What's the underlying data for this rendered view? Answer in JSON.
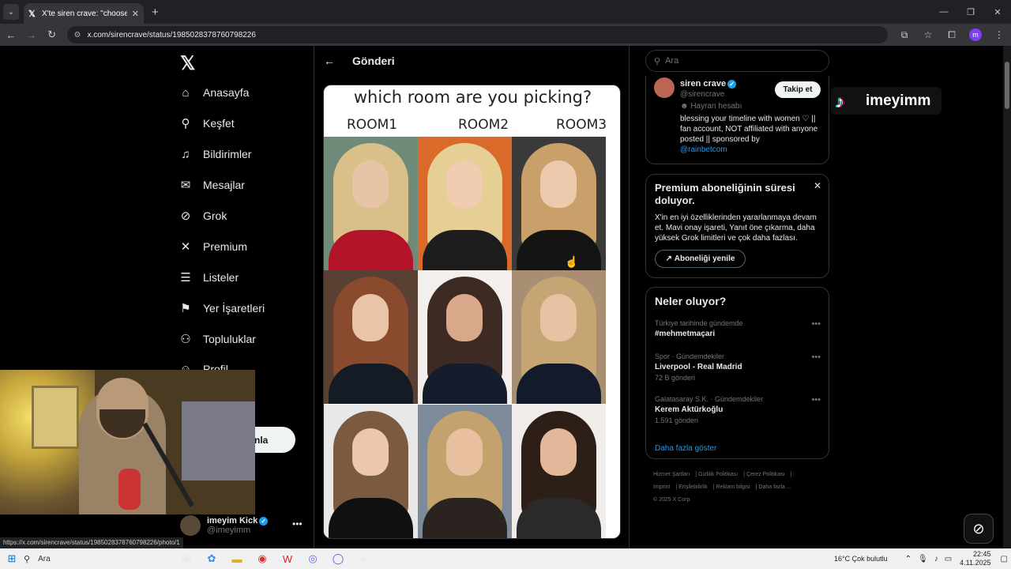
{
  "browser": {
    "tab_title": "X'te siren crave: \"choose one r",
    "url": "x.com/sirencrave/status/1985028378760798226",
    "status_url": "https://x.com/sirencrave/status/1985028378760798226/photo/1",
    "profile_initial": "m"
  },
  "nav": {
    "items": [
      {
        "label": "Anasayfa",
        "icon": "home-icon"
      },
      {
        "label": "Keşfet",
        "icon": "search-icon"
      },
      {
        "label": "Bildirimler",
        "icon": "bell-icon"
      },
      {
        "label": "Mesajlar",
        "icon": "mail-icon"
      },
      {
        "label": "Grok",
        "icon": "grok-icon"
      },
      {
        "label": "Premium",
        "icon": "x-icon"
      },
      {
        "label": "Listeler",
        "icon": "list-icon"
      },
      {
        "label": "Yer İşaretleri",
        "icon": "bookmark-icon"
      },
      {
        "label": "Topluluklar",
        "icon": "communities-icon"
      },
      {
        "label": "Profil",
        "icon": "profile-icon"
      }
    ],
    "post_button_partial": "nla",
    "account": {
      "name": "imeyim Kick",
      "handle": "@imeyimm"
    }
  },
  "post": {
    "header_title": "Gönderi",
    "image_question": "which room are you picking?",
    "rooms": [
      "ROOM1",
      "ROOM2",
      "ROOM3"
    ]
  },
  "right": {
    "search_placeholder": "Ara",
    "profile": {
      "name": "siren crave",
      "handle": "@sirencrave",
      "tag": "Hayran hesabı",
      "bio_1": "blessing your timeline with women",
      "bio_2": "♡ || fan account, NOT affiliated with anyone posted || sponsored by",
      "bio_link": "@rainbetcom",
      "follow_label": "Takip et"
    },
    "premium": {
      "title": "Premium aboneliğinin süresi doluyor.",
      "text": "X'in en iyi özelliklerinden yararlanmaya devam et. Mavi onay işareti, Yanıt öne çıkarma, daha yüksek Grok limitleri ve çok daha fazlası.",
      "button": "Aboneliği yenile"
    },
    "trends": {
      "title": "Neler oluyor?",
      "items": [
        {
          "context": "Türkiye tarihinde gündemde",
          "name": "#mehmetmaçari",
          "posts": ""
        },
        {
          "context": "Spor · Gündemdekiler",
          "name": "Liverpool - Real Madrid",
          "posts": "72 B gönderi"
        },
        {
          "context": "Galatasaray S.K. · Gündemdekiler",
          "name": "Kerem Aktürkoğlu",
          "posts": "1.591 gönderi"
        }
      ],
      "show_more": "Daha fazla göster"
    },
    "footer": [
      "Hizmet Şartları",
      "Gizlilik Politikası",
      "Çerez Politikası",
      "Imprint",
      "Erişilebilirlik",
      "Reklam bilgisi",
      "Daha fazla ...",
      "© 2025 X Corp."
    ]
  },
  "overlay": {
    "tiktok_name": "imeyimm"
  },
  "taskbar": {
    "search": "Ara",
    "weather": "16°C  Çok bulutlu",
    "time": "22:45",
    "date": "4.11.2025"
  }
}
